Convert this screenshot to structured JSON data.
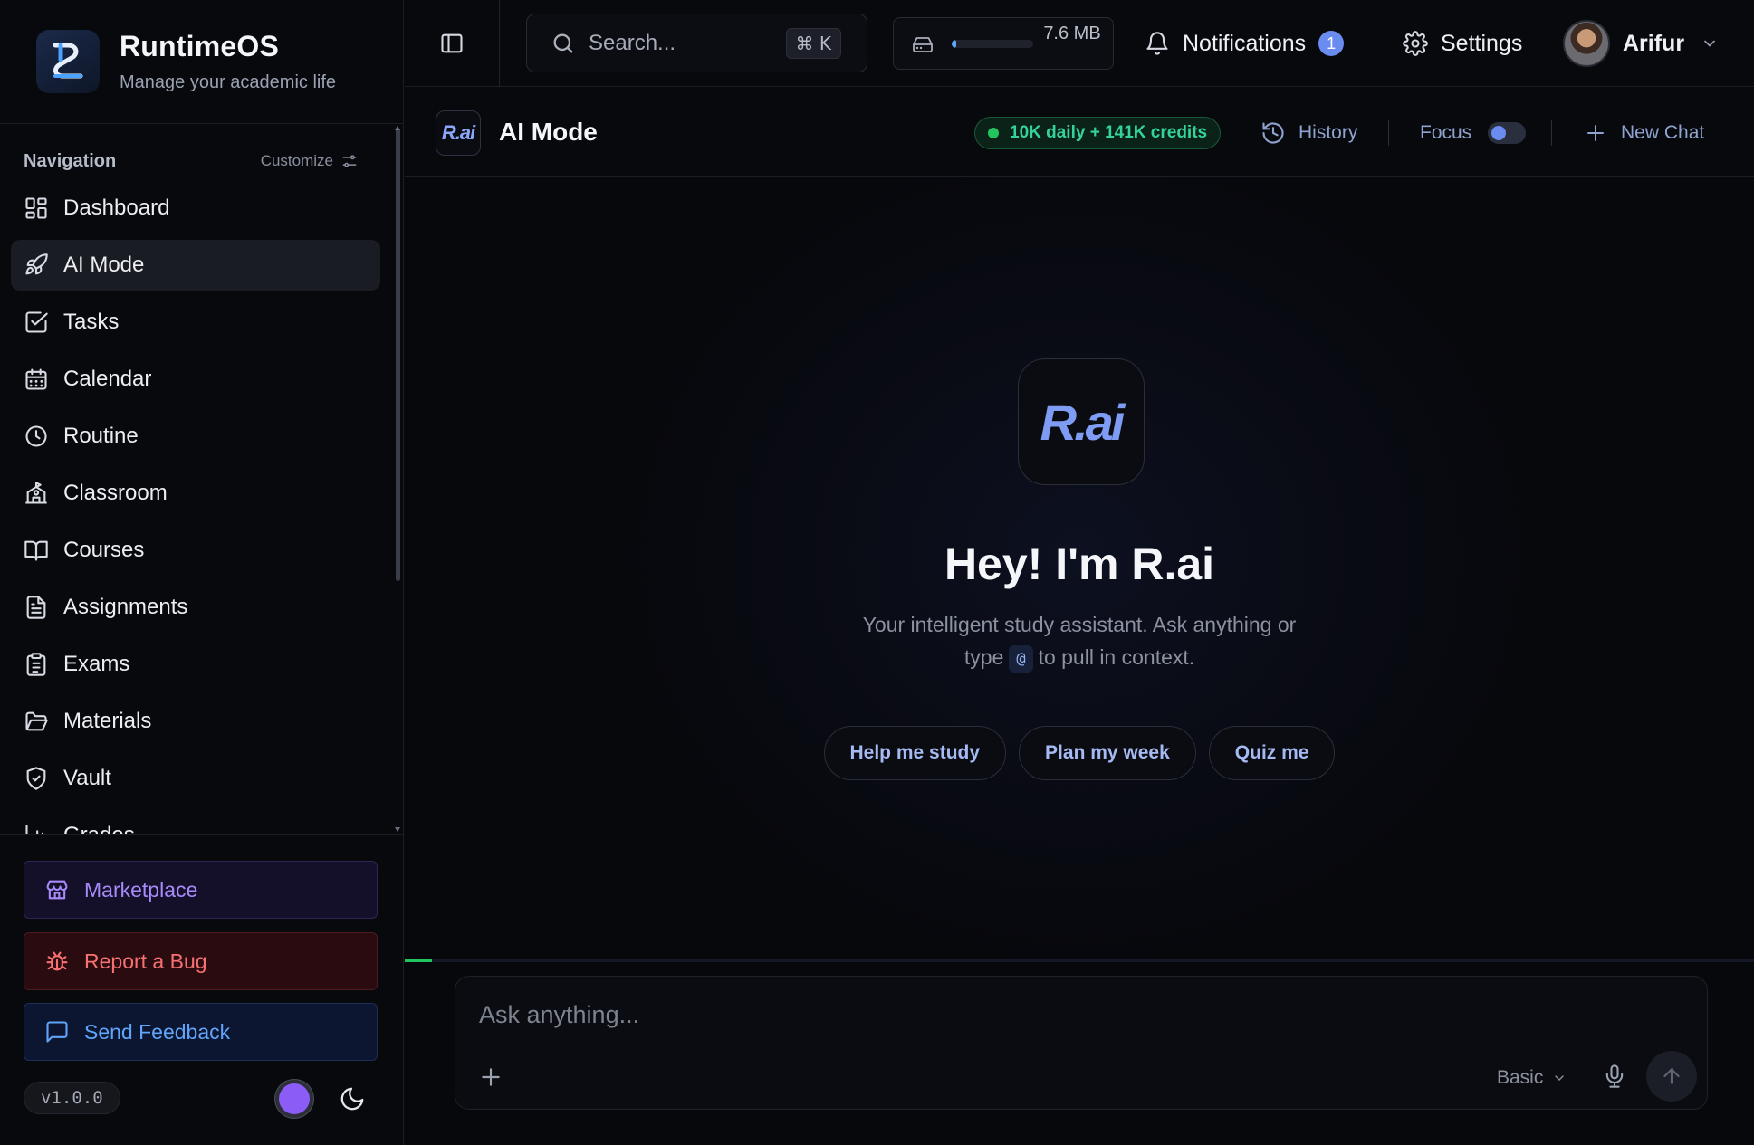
{
  "brand": {
    "name": "RuntimeOS",
    "tagline": "Manage your academic life"
  },
  "sidebar": {
    "nav_title": "Navigation",
    "customize_label": "Customize",
    "items": [
      {
        "label": "Dashboard",
        "icon": "dashboard-icon",
        "active": false
      },
      {
        "label": "AI Mode",
        "icon": "rocket-icon",
        "active": true
      },
      {
        "label": "Tasks",
        "icon": "checkbox-icon",
        "active": false
      },
      {
        "label": "Calendar",
        "icon": "calendar-icon",
        "active": false
      },
      {
        "label": "Routine",
        "icon": "clock-icon",
        "active": false
      },
      {
        "label": "Classroom",
        "icon": "school-icon",
        "active": false
      },
      {
        "label": "Courses",
        "icon": "book-icon",
        "active": false
      },
      {
        "label": "Assignments",
        "icon": "document-icon",
        "active": false
      },
      {
        "label": "Exams",
        "icon": "clipboard-icon",
        "active": false
      },
      {
        "label": "Materials",
        "icon": "folder-icon",
        "active": false
      },
      {
        "label": "Vault",
        "icon": "shield-icon",
        "active": false
      },
      {
        "label": "Grades",
        "icon": "chart-icon",
        "active": false
      }
    ],
    "actions": {
      "marketplace": "Marketplace",
      "report_bug": "Report a Bug",
      "send_feedback": "Send Feedback"
    },
    "version": "v1.0.0",
    "theme_color": "#8b5cf6"
  },
  "topbar": {
    "search_placeholder": "Search...",
    "search_shortcut": "⌘ K",
    "storage": {
      "used": "7.6 MB",
      "fill_fraction": 0.05
    },
    "notifications_label": "Notifications",
    "notifications_count": "1",
    "settings_label": "Settings",
    "user_name": "Arifur"
  },
  "header": {
    "logo_text": "R.ai",
    "title": "AI Mode",
    "credits": "10K daily + 141K credits",
    "history_label": "History",
    "focus_label": "Focus",
    "focus_on": false,
    "new_chat_label": "New Chat"
  },
  "hero": {
    "logo_text": "R.ai",
    "title": "Hey! I'm R.ai",
    "subtitle_line1": "Your intelligent study assistant. Ask anything or",
    "subtitle_pre": "type",
    "subtitle_chip": "@",
    "subtitle_post": "to pull in context.",
    "suggestions": [
      "Help me study",
      "Plan my week",
      "Quiz me"
    ]
  },
  "composer": {
    "placeholder": "Ask anything...",
    "model": "Basic"
  },
  "colors": {
    "accent": "#6a8cf0",
    "credits_green": "#34d399",
    "bug_red": "#f87171",
    "market_purple": "#a78bfa",
    "feedback_blue": "#60a5fa"
  }
}
